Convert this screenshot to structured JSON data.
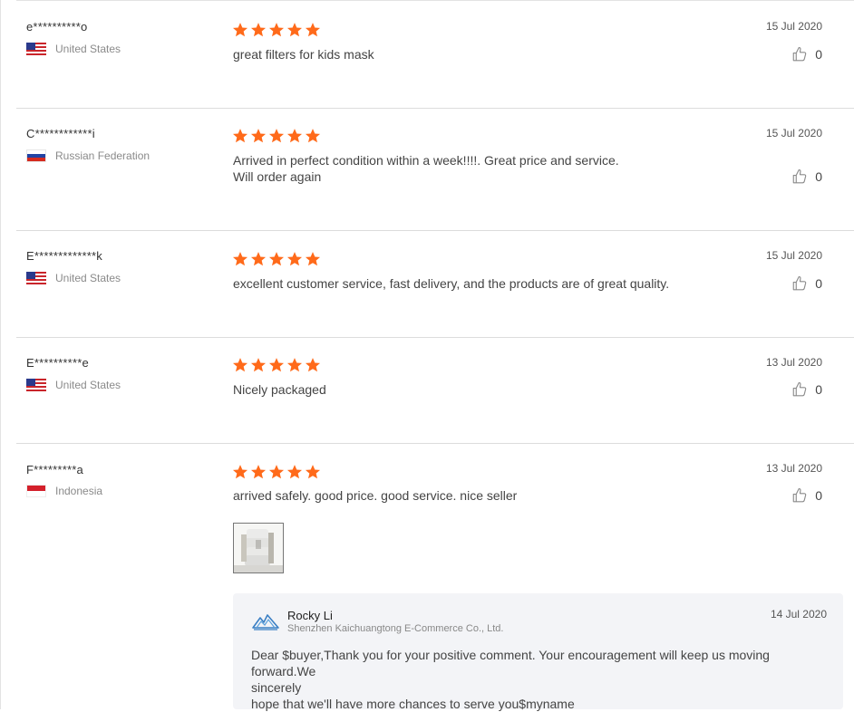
{
  "colors": {
    "star": "#ff6a1a",
    "divider": "#dcdcdc",
    "reply_background": "#f3f4f7"
  },
  "icons": {
    "star": "star-icon",
    "like": "thumbs-up-icon",
    "seller": "seller-logo-icon"
  },
  "reviews": [
    {
      "user": "e**********o",
      "country": "United States",
      "flag": "us-flag-icon",
      "rating": 5,
      "text": "great filters for kids mask",
      "date": "15 Jul 2020",
      "likes": "0"
    },
    {
      "user": "C************i",
      "country": "Russian Federation",
      "flag": "ru-flag-icon",
      "rating": 5,
      "text_line1": "Arrived in perfect condition within a week!!!!. Great price and service.",
      "text_line2": "Will order again",
      "date": "15 Jul 2020",
      "likes": "0"
    },
    {
      "user": "E*************k",
      "country": "United States",
      "flag": "us-flag-icon",
      "rating": 5,
      "text": "excellent customer service, fast delivery, and the products are of great quality.",
      "date": "15 Jul 2020",
      "likes": "0"
    },
    {
      "user": "E**********e",
      "country": "United States",
      "flag": "us-flag-icon",
      "rating": 5,
      "text": "Nicely packaged",
      "date": "13 Jul 2020",
      "likes": "0"
    },
    {
      "user": "F*********a",
      "country": "Indonesia",
      "flag": "id-flag-icon",
      "rating": 5,
      "text": "arrived safely. good price. good service. nice seller",
      "date": "13 Jul 2020",
      "likes": "0",
      "photo": "review-photo-thumbnail",
      "seller_reply": {
        "name": "Rocky Li",
        "company": "Shenzhen Kaichuangtong E-Commerce Co., Ltd.",
        "date": "14 Jul 2020",
        "line1": "Dear $buyer,Thank you for your positive comment. Your encouragement will keep us moving forward.We",
        "line2": "sincerely",
        "line3": "hope that we'll have more chances to serve you$myname"
      }
    }
  ]
}
